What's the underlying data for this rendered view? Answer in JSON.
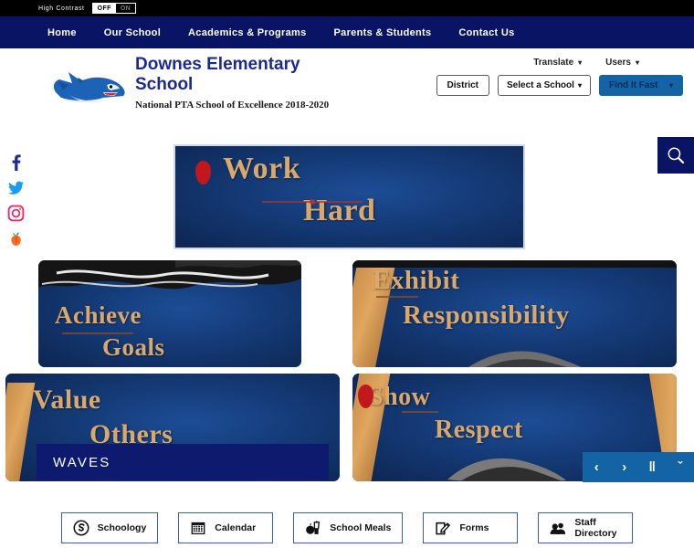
{
  "accessibility": {
    "label": "High Contrast",
    "options": [
      "OFF",
      "ON"
    ],
    "selected": "OFF"
  },
  "nav": {
    "items": [
      {
        "label": "Home",
        "name": "home"
      },
      {
        "label": "Our School",
        "name": "our-school"
      },
      {
        "label": "Academics & Programs",
        "name": "academics-programs"
      },
      {
        "label": "Parents & Students",
        "name": "parents-students"
      },
      {
        "label": "Contact Us",
        "name": "contact-us"
      }
    ]
  },
  "header": {
    "school_name": "Downes Elementary School",
    "tagline": "National PTA School of Excellence 2018-2020",
    "logo_icon": "shark-mascot-logo",
    "translate_label": "Translate",
    "users_label": "Users",
    "district_label": "District",
    "school_select_value": "Select a School",
    "find_it_fast_label": "Find It Fast",
    "search_icon": "search-icon"
  },
  "social": {
    "items": [
      {
        "name": "facebook-icon",
        "label": "Facebook",
        "color": "#1b2a91"
      },
      {
        "name": "twitter-icon",
        "label": "Twitter",
        "color": "#1d9bf0"
      },
      {
        "name": "instagram-icon",
        "label": "Instagram",
        "color": "#e1306c"
      },
      {
        "name": "peachjar-icon",
        "label": "Peachjar",
        "color": "#f26c2a"
      }
    ]
  },
  "carousel": {
    "caption": "WAVES",
    "panels": [
      {
        "name": "work-hard",
        "line1": "Work",
        "line2": "Hard"
      },
      {
        "name": "achieve-goals",
        "line1": "Achieve",
        "line2": "Goals"
      },
      {
        "name": "exhibit-responsibility",
        "line1": "Exhibit",
        "line2": "Responsibility"
      },
      {
        "name": "value-others",
        "line1": "Value",
        "line2": "Others"
      },
      {
        "name": "show-respect",
        "line1": "Show",
        "line2": "Respect"
      }
    ],
    "controls": [
      {
        "name": "previous-slide-button",
        "glyph": "‹"
      },
      {
        "name": "next-slide-button",
        "glyph": "›"
      },
      {
        "name": "pause-slideshow-button",
        "glyph": "‖"
      },
      {
        "name": "expand-carousel-button",
        "glyph": "ˇ"
      }
    ]
  },
  "quicklinks": {
    "items": [
      {
        "label": "Schoology",
        "icon": "schoology-icon"
      },
      {
        "label": "Calendar",
        "icon": "calendar-icon"
      },
      {
        "label": "School Meals",
        "icon": "school-meals-icon"
      },
      {
        "label": "Forms",
        "icon": "forms-icon"
      },
      {
        "label": "Staff\nDirectory",
        "icon": "staff-directory-icon"
      }
    ]
  },
  "colors": {
    "navy": "#0a1464",
    "blue_accent": "#1464a5",
    "panel_blue": "#123a7a",
    "gold": "#d9a86a",
    "link_border": "#3c5bbf"
  }
}
